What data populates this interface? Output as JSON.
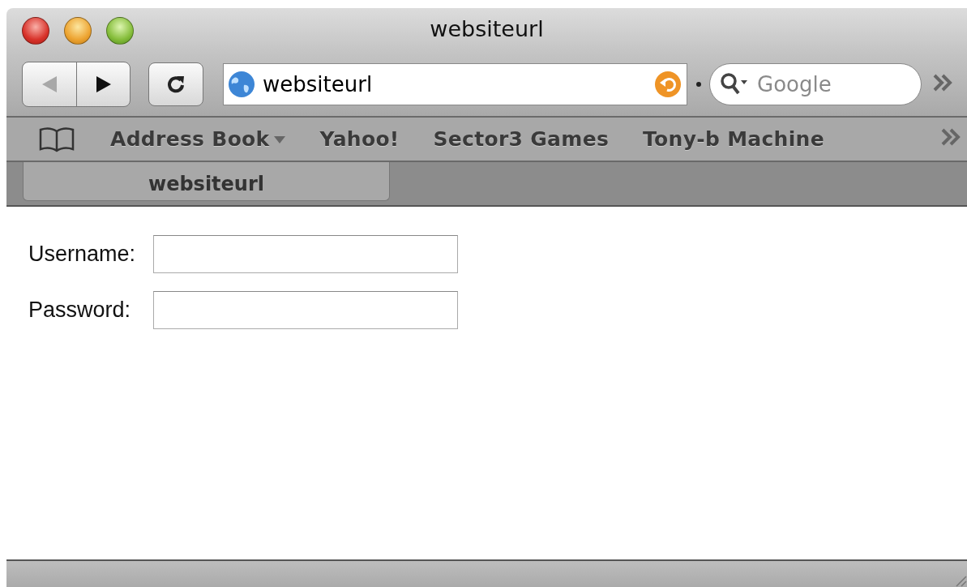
{
  "window": {
    "title": "websiteurl"
  },
  "toolbar": {
    "back": {
      "disabled": true
    },
    "forward": {
      "disabled": false
    },
    "address": {
      "value": "websiteurl"
    },
    "search": {
      "placeholder": "Google"
    }
  },
  "bookmarks": [
    {
      "label": "Address Book",
      "kind": "menu"
    },
    {
      "label": "Yahoo!",
      "kind": "link"
    },
    {
      "label": "Sector3 Games",
      "kind": "link"
    },
    {
      "label": "Tony-b Machine",
      "kind": "link"
    }
  ],
  "tabs": [
    {
      "label": "websiteurl",
      "selected": true
    }
  ],
  "form": {
    "fields": [
      {
        "label": "Username:"
      },
      {
        "label": "Password:"
      }
    ]
  }
}
